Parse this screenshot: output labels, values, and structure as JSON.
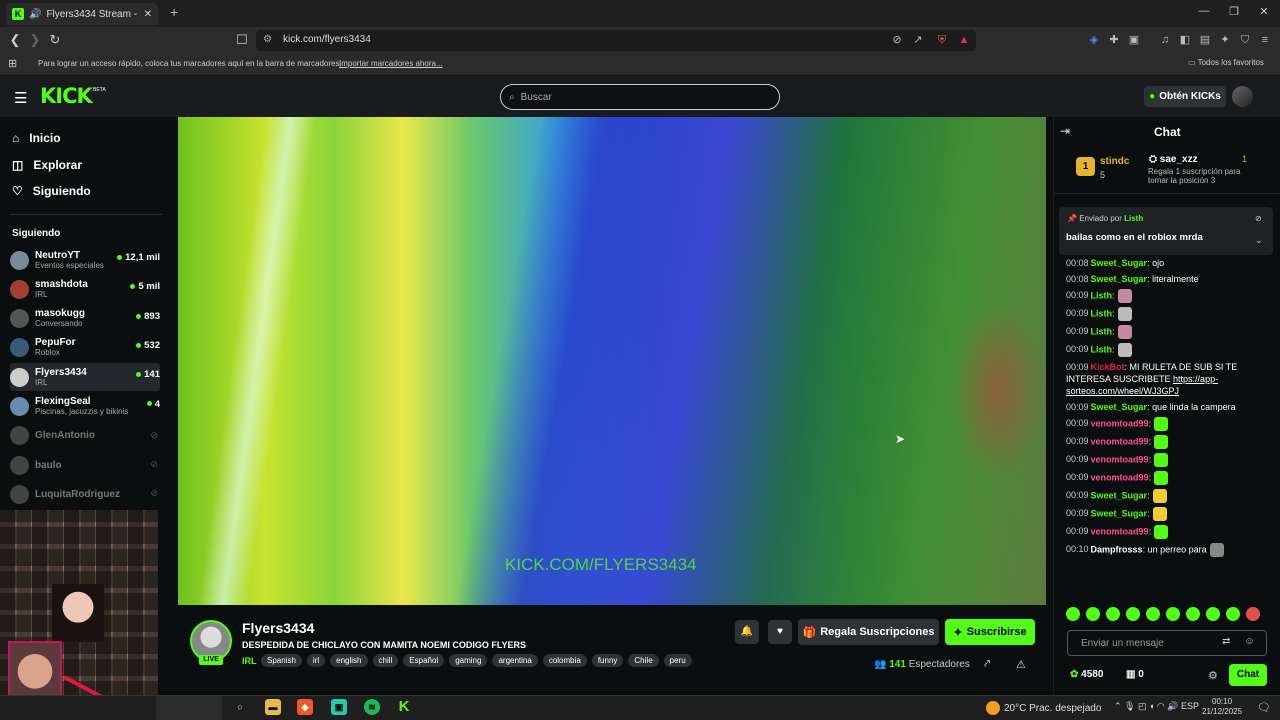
{
  "browser": {
    "tab_title": "Flyers3434 Stream - Watch Li",
    "url": "kick.com/flyers3434",
    "bookmark_prompt": "Para lograr un acceso rápido, coloca tus marcadores aquí en la barra de marcadores.",
    "bookmark_import_link": "Importar marcadores ahora...",
    "favorites": "Todos los favoritos"
  },
  "header": {
    "logo": "KICK",
    "beta": "BETA",
    "search_placeholder": "Buscar",
    "get_kicks": "Obtén KICKs"
  },
  "sidebar": {
    "nav": [
      {
        "label": "Inicio",
        "icon": "home-icon"
      },
      {
        "label": "Explorar",
        "icon": "compass-icon"
      },
      {
        "label": "Siguiendo",
        "icon": "heart-icon"
      }
    ],
    "following_title": "Siguiendo",
    "following": [
      {
        "name": "NeutroYT",
        "category": "Eventos especiales",
        "viewers": "12,1 mil",
        "live": true,
        "color": "#7a8a9a"
      },
      {
        "name": "smashdota",
        "category": "IRL",
        "viewers": "5 mil",
        "live": true,
        "color": "#a04030"
      },
      {
        "name": "masokugg",
        "category": "Conversando",
        "viewers": "893",
        "live": true,
        "color": "#555555"
      },
      {
        "name": "PepuFor",
        "category": "Roblox",
        "viewers": "532",
        "live": true,
        "color": "#3a5a7a"
      },
      {
        "name": "Flyers3434",
        "category": "IRL",
        "viewers": "141",
        "live": true,
        "color": "#cccccc"
      },
      {
        "name": "FlexingSeal",
        "category": "Piscinas, jacuzzis y bikinis",
        "viewers": "4",
        "live": true,
        "color": "#6a8ab0"
      },
      {
        "name": "GlenAntonio",
        "category": "",
        "viewers": "",
        "live": false,
        "color": "#444444"
      },
      {
        "name": "baulo",
        "category": "",
        "viewers": "",
        "live": false,
        "color": "#444444"
      },
      {
        "name": "LuquitaRodriguez",
        "category": "",
        "viewers": "",
        "live": false,
        "color": "#444444"
      }
    ]
  },
  "stream": {
    "watermark": "KICK.COM/FLYERS3434",
    "streamer": "Flyers3434",
    "live_badge": "LIVE",
    "title": "DESPEDIDA DE CHICLAYO CON MAMITA NOEMI CODIGO FLYERS",
    "category": "IRL",
    "tags": [
      "Spanish",
      "irl",
      "english",
      "chill",
      "Español",
      "gaming",
      "argentina",
      "colombia",
      "funny",
      "Chile",
      "peru"
    ],
    "gift_button": "Regala Suscripciones",
    "subscribe_button": "Suscribirse",
    "viewers_count": "141",
    "viewers_label": "Espectadores"
  },
  "chat": {
    "title": "Chat",
    "leaderboard": {
      "rank": "1",
      "top_name": "stindc",
      "top_count": "5",
      "user": "sae_xzz",
      "user_count": "1",
      "desc": "Regala 1 suscripción para tomar la posición 3"
    },
    "pinned": {
      "by_label": "Enviado por",
      "by_user": "Listh",
      "message": "bailas como en el roblox mrda"
    },
    "messages": [
      {
        "time": "00:08",
        "user": "Sweet_Sugar",
        "color": "#53fc18",
        "text": ": ojo",
        "emote": ""
      },
      {
        "time": "00:08",
        "user": "Sweet_Sugar",
        "color": "#53fc18",
        "text": ": literalmente",
        "emote": ""
      },
      {
        "time": "00:09",
        "user": "Listh",
        "color": "#53fc18",
        "text": ":",
        "emote": "#c58aa0"
      },
      {
        "time": "00:09",
        "user": "Listh",
        "color": "#53fc18",
        "text": ":",
        "emote": "#bbbbbb"
      },
      {
        "time": "00:09",
        "user": "Listh",
        "color": "#53fc18",
        "text": ":",
        "emote": "#c58aa0"
      },
      {
        "time": "00:09",
        "user": "Listh",
        "color": "#53fc18",
        "text": ":",
        "emote": "#bbbbbb"
      },
      {
        "time": "00:09",
        "user": "KickBot",
        "color": "#e02050",
        "text": ": MI RULETA DE SUB SI TE INTERESA SUSCRIBETE",
        "link": "https://app-sorteos.com/wheel/WJ3GPJ",
        "emote": ""
      },
      {
        "time": "00:09",
        "user": "Sweet_Sugar",
        "color": "#53fc18",
        "text": ": que linda la campera",
        "emote": ""
      },
      {
        "time": "00:09",
        "user": "venomtoad99",
        "color": "#ff4f9a",
        "text": ":",
        "emote": "#53fc18"
      },
      {
        "time": "00:09",
        "user": "venomtoad99",
        "color": "#ff4f9a",
        "text": ":",
        "emote": "#53fc18"
      },
      {
        "time": "00:09",
        "user": "venomtoad99",
        "color": "#ff4f9a",
        "text": ":",
        "emote": "#53fc18"
      },
      {
        "time": "00:09",
        "user": "venomtoad99",
        "color": "#ff4f9a",
        "text": ":",
        "emote": "#53fc18"
      },
      {
        "time": "00:09",
        "user": "Sweet_Sugar",
        "color": "#53fc18",
        "text": ":",
        "emote": "#f0d030"
      },
      {
        "time": "00:09",
        "user": "Sweet_Sugar",
        "color": "#53fc18",
        "text": ":",
        "emote": "#f0d030"
      },
      {
        "time": "00:09",
        "user": "venomtoad99",
        "color": "#ff4f9a",
        "text": ":",
        "emote": "#53fc18"
      },
      {
        "time": "00:10",
        "user": "Dampfrosss",
        "color": "#ffffff",
        "text": ": un perreo para",
        "emote": "#888888"
      }
    ],
    "input_placeholder": "Enviar un mensaje",
    "kicks_balance": "4580",
    "chest_balance": "0",
    "chat_button": "Chat"
  },
  "taskbar": {
    "weather": "20°C  Prac. despejado",
    "lang": "ESP",
    "time": "00:10",
    "date": "21/12/2025",
    "notif_count": "4"
  }
}
